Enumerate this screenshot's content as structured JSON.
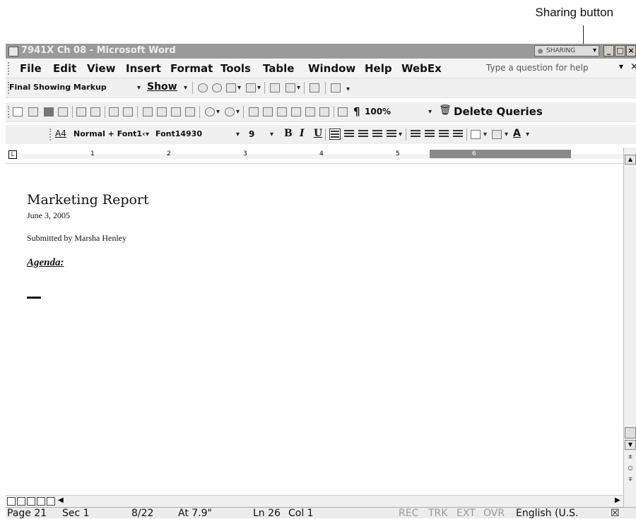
{
  "callout": {
    "label": "Sharing button"
  },
  "window": {
    "title": "7941X Ch 08 - Microsoft Word",
    "sharing_label": "SHARING",
    "minimize": "_",
    "restore": "□",
    "close": "×"
  },
  "menubar": {
    "items": [
      "File",
      "Edit",
      "View",
      "Insert",
      "Format",
      "Tools",
      "Table",
      "Window",
      "Help",
      "WebEx"
    ],
    "help_placeholder": "Type a question for help",
    "help_drop": "▾",
    "close": "×"
  },
  "reviewing": {
    "markup_select": "Final Showing Markup",
    "show_label": "Show"
  },
  "standard": {
    "zoom": "100%",
    "pilcrow": "¶",
    "delete_queries": "Delete Queries"
  },
  "formatting": {
    "style": "Normal + Font1‹",
    "font": "Font14930",
    "size": "9",
    "bold": "B",
    "italic": "I",
    "underline": "U"
  },
  "ruler": {
    "numbers": [
      "1",
      "2",
      "3",
      "4",
      "5",
      "6"
    ]
  },
  "document": {
    "title": "Marketing Report",
    "date": "June 3, 2005",
    "submitted": "Submitted by Marsha Henley",
    "agenda": "Agenda:"
  },
  "statusbar": {
    "page": "Page 21",
    "sec": "Sec 1",
    "pages": "8/22",
    "at": "At 7.9\"",
    "ln": "Ln 26",
    "col": "Col 1",
    "rec": "REC",
    "trk": "TRK",
    "ext": "EXT",
    "ovr": "OVR",
    "language": "English (U.S."
  },
  "icons": [
    "sharing-icon",
    "new-icon",
    "open-icon",
    "save-icon",
    "print-icon",
    "spell-icon",
    "cut-icon",
    "copy-icon",
    "paste-icon",
    "undo-icon",
    "redo-icon",
    "table-icon",
    "pilcrow-icon",
    "delete-icon"
  ]
}
